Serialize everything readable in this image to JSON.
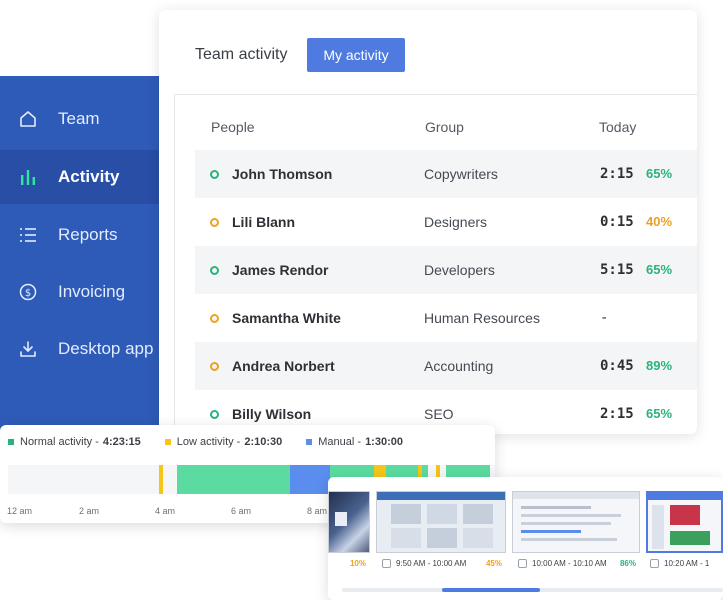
{
  "sidebar": {
    "items": [
      {
        "label": "Team",
        "icon": "home-icon"
      },
      {
        "label": "Activity",
        "icon": "bar-chart-icon",
        "active": true
      },
      {
        "label": "Reports",
        "icon": "list-icon"
      },
      {
        "label": "Invoicing",
        "icon": "dollar-circle-icon"
      },
      {
        "label": "Desktop app",
        "icon": "download-icon"
      }
    ]
  },
  "card": {
    "title": "Team activity",
    "button": "My activity",
    "headers": {
      "people": "People",
      "group": "Group",
      "today": "Today"
    },
    "rows": [
      {
        "name": "John Thomson",
        "group": "Copywriters",
        "time": "2:15",
        "pct": "65%",
        "status": "green",
        "pct_color": "#2ab27b"
      },
      {
        "name": "Lili Blann",
        "group": "Designers",
        "time": "0:15",
        "pct": "40%",
        "status": "amber",
        "pct_color": "#f0a020"
      },
      {
        "name": "James Rendor",
        "group": "Developers",
        "time": "5:15",
        "pct": "65%",
        "status": "green",
        "pct_color": "#2ab27b"
      },
      {
        "name": "Samantha White",
        "group": "Human Resources",
        "time": "-",
        "pct": "",
        "status": "amber",
        "pct_color": "#2ab27b"
      },
      {
        "name": "Andrea Norbert",
        "group": "Accounting",
        "time": "0:45",
        "pct": "89%",
        "status": "amber",
        "pct_color": "#2ab27b"
      },
      {
        "name": "Billy Wilson",
        "group": "SEO",
        "time": "2:15",
        "pct": "65%",
        "status": "green",
        "pct_color": "#2ab27b"
      }
    ]
  },
  "timeline": {
    "legend": [
      {
        "label": "Normal activity - ",
        "value": "4:23:15",
        "color": "#2ab27b"
      },
      {
        "label": "Low activity - ",
        "value": "2:10:30",
        "color": "#f5c518"
      },
      {
        "label": "Manual - ",
        "value": "1:30:00",
        "color": "#5b8def"
      }
    ],
    "ticks": [
      "12 am",
      "2 am",
      "4 am",
      "6 am",
      "8 am"
    ]
  },
  "screenshots": {
    "items": [
      {
        "range": "",
        "pct": "10%",
        "pct_color": "#f0a020"
      },
      {
        "range": "9:50 AM - 10:00 AM",
        "pct": "45%",
        "pct_color": "#f0a020"
      },
      {
        "range": "10:00 AM - 10:10 AM",
        "pct": "86%",
        "pct_color": "#2ab27b"
      },
      {
        "range": "10:20 AM - 1",
        "pct": "",
        "pct_color": "#2ab27b"
      }
    ]
  },
  "colors": {
    "sidebar": "#2f5bb8",
    "accent": "#4f7be0",
    "green": "#2ab27b",
    "amber": "#f0a020"
  }
}
